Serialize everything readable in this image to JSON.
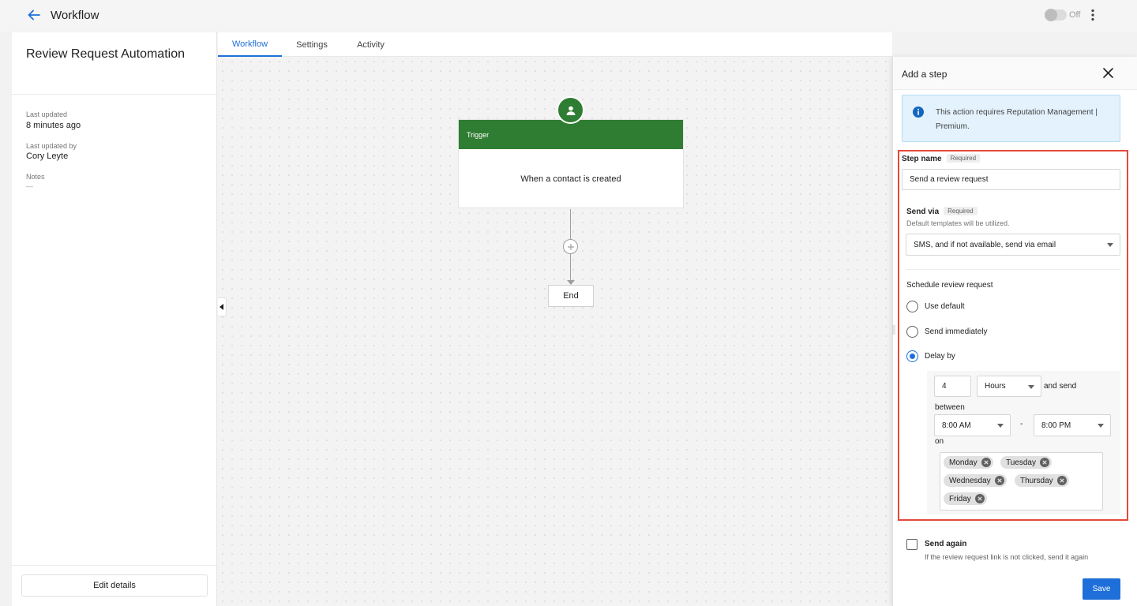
{
  "topbar": {
    "title": "Workflow",
    "toggle_label": "Off"
  },
  "left_panel": {
    "title": "Review Request Automation",
    "last_updated_label": "Last updated",
    "last_updated_value": "8 minutes ago",
    "last_updated_by_label": "Last updated by",
    "last_updated_by_value": "Cory Leyte",
    "notes_label": "Notes",
    "notes_value": "—",
    "edit_button": "Edit details"
  },
  "tabs": [
    {
      "label": "Workflow",
      "active": true
    },
    {
      "label": "Settings",
      "active": false
    },
    {
      "label": "Activity",
      "active": false
    }
  ],
  "canvas": {
    "trigger_header": "Trigger",
    "trigger_text": "When a contact is created",
    "end_label": "End"
  },
  "drawer": {
    "title": "Add a step",
    "info_text": "This action requires Reputation Management | Premium.",
    "step_name_label": "Step name",
    "required_chip": "Required",
    "step_name_value": "Send a review request",
    "send_via_label": "Send via",
    "send_via_helper": "Default templates will be utilized.",
    "send_via_value": "SMS, and if not available, send via email",
    "schedule_label": "Schedule review request",
    "radio_options": [
      {
        "label": "Use default",
        "checked": false
      },
      {
        "label": "Send immediately",
        "checked": false
      },
      {
        "label": "Delay by",
        "checked": true
      }
    ],
    "delay_amount": "4",
    "delay_unit": "Hours",
    "and_send": "and send",
    "between": "between",
    "start_time": "8:00 AM",
    "dash": "-",
    "end_time": "8:00 PM",
    "on": "on",
    "days": [
      "Monday",
      "Tuesday",
      "Wednesday",
      "Thursday",
      "Friday"
    ],
    "send_again_label": "Send again",
    "send_again_desc": "If the review request link is not clicked, send it again",
    "save_button": "Save"
  },
  "colors": {
    "accent": "#1e6fd9",
    "trigger_green": "#2e7d32",
    "highlight_red": "#e5483b",
    "info_bg": "#e3f2fd"
  }
}
